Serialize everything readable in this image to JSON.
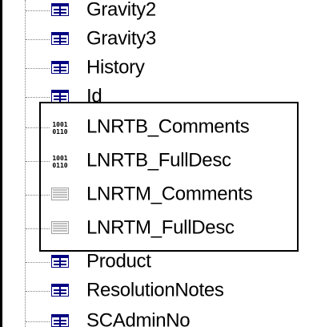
{
  "tree": {
    "items": [
      {
        "label": "Gravity2",
        "icon": "table-field-icon"
      },
      {
        "label": "Gravity3",
        "icon": "table-field-icon"
      },
      {
        "label": "History",
        "icon": "table-field-icon"
      },
      {
        "label": "Id",
        "icon": "table-field-icon"
      },
      {
        "label": "LNRTB_Comments",
        "icon": "binary-field-icon"
      },
      {
        "label": "LNRTB_FullDesc",
        "icon": "binary-field-icon"
      },
      {
        "label": "LNRTM_Comments",
        "icon": "memo-field-icon"
      },
      {
        "label": "LNRTM_FullDesc",
        "icon": "memo-field-icon"
      },
      {
        "label": "Product",
        "icon": "table-field-icon"
      },
      {
        "label": "ResolutionNotes",
        "icon": "table-field-icon"
      },
      {
        "label": "SCAdminNo",
        "icon": "table-field-icon"
      }
    ]
  },
  "colors": {
    "table_icon": "#000080",
    "binary_icon": "#000000",
    "memo_icon": "#808080",
    "selection_border": "#000000"
  }
}
